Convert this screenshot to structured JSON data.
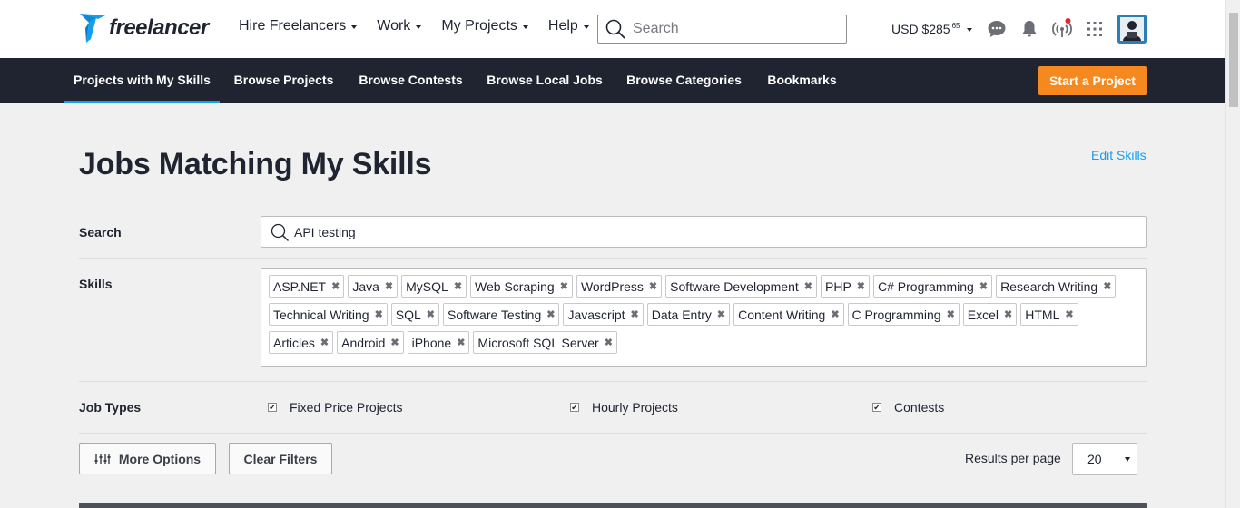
{
  "header": {
    "logo_text": "freelancer",
    "nav": [
      {
        "label": "Hire Freelancers"
      },
      {
        "label": "Work"
      },
      {
        "label": "My Projects"
      },
      {
        "label": "Help"
      }
    ],
    "search_placeholder": "Search",
    "balance": "USD $285",
    "balance_cents": "65",
    "icons": [
      "chat-icon",
      "bell-icon",
      "signal-icon",
      "apps-grid-icon"
    ]
  },
  "subnav": {
    "items": [
      {
        "label": "Projects with My Skills",
        "active": true
      },
      {
        "label": "Browse Projects"
      },
      {
        "label": "Browse Contests"
      },
      {
        "label": "Browse Local Jobs"
      },
      {
        "label": "Browse Categories"
      },
      {
        "label": "Bookmarks"
      }
    ],
    "cta": "Start a Project"
  },
  "main": {
    "title": "Jobs Matching My Skills",
    "edit_skills": "Edit Skills",
    "search_label": "Search",
    "search_value": "API testing",
    "skills_label": "Skills",
    "skills": [
      "ASP.NET",
      "Java",
      "MySQL",
      "Web Scraping",
      "WordPress",
      "Software Development",
      "PHP",
      "C# Programming",
      "Research Writing",
      "Technical Writing",
      "SQL",
      "Software Testing",
      "Javascript",
      "Data Entry",
      "Content Writing",
      "C Programming",
      "Excel",
      "HTML",
      "Articles",
      "Android",
      "iPhone",
      "Microsoft SQL Server"
    ],
    "job_types_label": "Job Types",
    "job_types": [
      {
        "label": "Fixed Price Projects",
        "checked": true
      },
      {
        "label": "Hourly Projects",
        "checked": true
      },
      {
        "label": "Contests",
        "checked": true
      }
    ],
    "more_options": "More Options",
    "clear_filters": "Clear Filters",
    "results_per_page_label": "Results per page",
    "results_per_page": "20"
  },
  "colors": {
    "brand_dark": "#1f2430",
    "accent_blue": "#139ff0",
    "cta_orange": "#f5881f"
  }
}
